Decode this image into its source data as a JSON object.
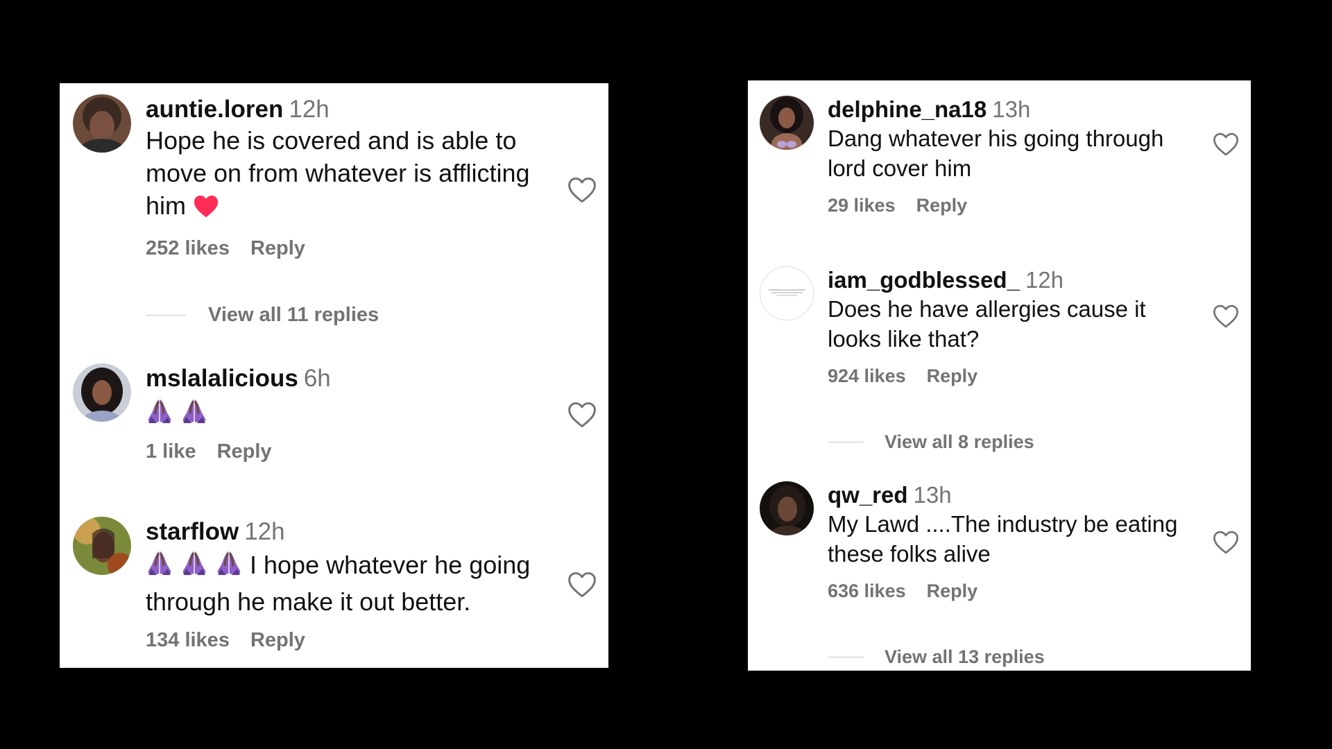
{
  "panels": [
    {
      "comments": [
        {
          "username": "auntie.loren",
          "time": "12h",
          "lines": [
            "Hope he is covered and is able to",
            "move on from whatever is afflicting",
            "him"
          ],
          "trailing_emoji": "red-heart-emoji",
          "likes": "252 likes",
          "reply": "Reply",
          "view_replies": "View all 11 replies"
        },
        {
          "username": "mslalalicious",
          "time": "6h",
          "lead_emojis": [
            "folded-hands-emoji",
            "folded-hands-emoji"
          ],
          "lines": [],
          "likes": "1 like",
          "reply": "Reply"
        },
        {
          "username": "starflow",
          "time": "12h",
          "lead_emojis": [
            "folded-hands-emoji",
            "folded-hands-emoji",
            "folded-hands-emoji"
          ],
          "lines": [
            "I hope whatever he going",
            "through he make it out better."
          ],
          "likes": "134 likes",
          "reply": "Reply"
        }
      ]
    },
    {
      "comments": [
        {
          "username": "delphine_na18",
          "time": "13h",
          "lines": [
            "Dang whatever his going through",
            "lord cover him"
          ],
          "likes": "29 likes",
          "reply": "Reply"
        },
        {
          "username": "iam_godblessed_",
          "time": "12h",
          "lines": [
            "Does he have allergies cause it",
            "looks like that?"
          ],
          "likes": "924 likes",
          "reply": "Reply",
          "view_replies": "View all 8 replies"
        },
        {
          "username": "qw_red",
          "time": "13h",
          "lines": [
            "My Lawd ....The industry be eating",
            "these folks alive"
          ],
          "likes": "636 likes",
          "reply": "Reply",
          "view_replies": "View all 13 replies"
        }
      ]
    }
  ],
  "colors": {
    "background": "#000000",
    "panel": "#ffffff",
    "secondary_text": "#737373",
    "heart_emoji": "#ff2d55",
    "pray_emoji": "#8e5fc9"
  }
}
